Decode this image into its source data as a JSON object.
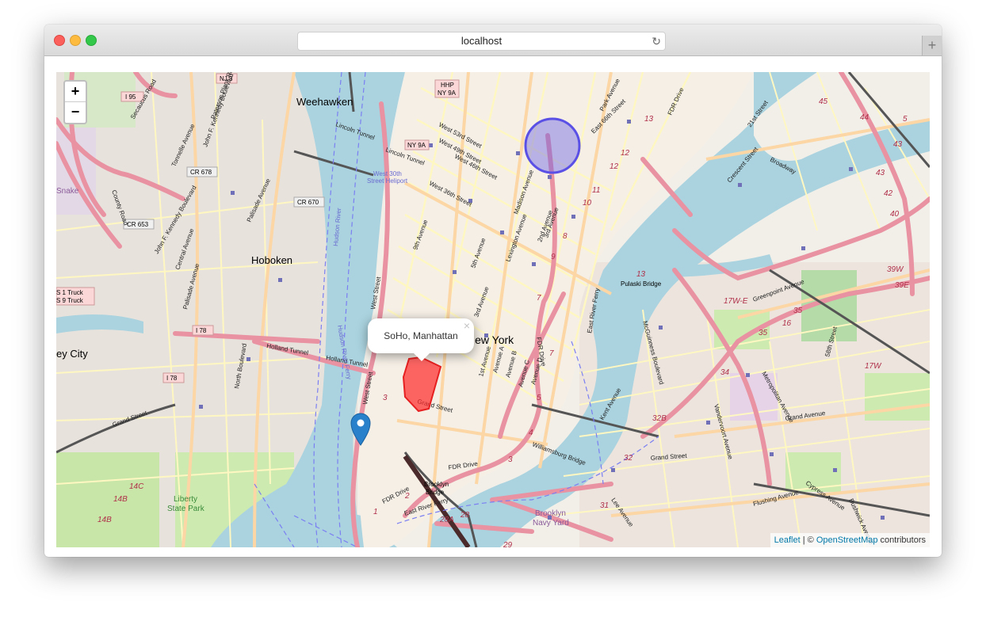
{
  "browser": {
    "url": "localhost",
    "new_tab_icon": "+",
    "reload_icon": "↻"
  },
  "map": {
    "zoom_in": "+",
    "zoom_out": "−",
    "popup": {
      "text": "SoHo, Manhattan",
      "close": "×"
    },
    "attribution": {
      "leaflet": "Leaflet",
      "separator": " | © ",
      "osm": "OpenStreetMap",
      "suffix": " contributors"
    },
    "colors": {
      "water": "#aad3df",
      "land": "#f2efe9",
      "park": "#cdebb0",
      "motorway": "#e892a2",
      "primary": "#fcd6a4",
      "circle": "#6d67e4",
      "polygon": "#ff2a2a",
      "marker": "#2a81cb"
    },
    "labels": {
      "weehawken": "Weehawken",
      "hoboken": "Hoboken",
      "newyork": "New York",
      "jerseycity": "ey City",
      "liberty": "Liberty",
      "statepark": "State Park",
      "brooklyn": "Brooklyn",
      "navyyard": "Navy Yard",
      "pulaski": "Pulaski Bridge",
      "brooklynbridge1": "Brooklyn",
      "brooklynbridge2": "Bridge",
      "heliport1": "West 30th",
      "heliport2": "Street Heliport",
      "snake": "Snake",
      "truck1": "S 1 Truck",
      "truck2": "S 9 Truck",
      "shields": {
        "nj3": "NJ 3",
        "i95": "I 95",
        "hhp": "HHP",
        "ny9a_top": "NY 9A",
        "ny9a": "NY 9A",
        "cr678": "CR 678",
        "cr670": "CR 670",
        "cr653": "CR 653",
        "i78": "I 78",
        "i78b": "I 78"
      },
      "streets": {
        "lincoln": "Lincoln Tunnel",
        "holland": "Holland Tunnel",
        "hollandtunnel2": "Holland Tunnel",
        "w53": "West 53rd Street",
        "w49": "West 49th Street",
        "w46": "West 46th Street",
        "w36": "West 36th Street",
        "westst": "West Street",
        "westst2": "West Street",
        "fdr": "FDR Drive",
        "fdr2": "FDR Drive",
        "fdr3": "FDR Drive",
        "fdr4": "FDR Drive",
        "grandst": "Grand Street",
        "grandst2": "Grand Street",
        "grandst3": "Grand Street",
        "grandave": "Grand Avenue",
        "williamsburg": "Williamsburg Bridge",
        "greenpoint": "Greenpoint Avenue",
        "broadway": "Broadway",
        "crescent": "Crescent Street",
        "palisade": "Palisade Avenue",
        "palisade2": "Palisade Avenue",
        "jfk": "John F. Kennedy Boulevard",
        "jfk2": "John F. Kennedy Boulevard",
        "central": "Central Avenue",
        "flushing": "Flushing Avenue",
        "cypress": "Cypress Avenue",
        "eastriver": "East River Ferry",
        "eastriver2": "East River Ferry",
        "mcguinness": "McGuinness Boulevard",
        "kent": "Kent Avenue",
        "parkave": "Park Avenue",
        "ave5": "5th Avenue",
        "ave9": "9th Avenue",
        "ave3": "3rd Avenue",
        "ave2": "2nd Avenue",
        "ave1": "1st Avenue",
        "lexington": "Lexington Avenue",
        "madison": "Madison Avenue",
        "avea": "Avenue A",
        "aveb": "Avenue B",
        "avec": "Avenue C",
        "aved": "Avenue D",
        "e66": "East 66th Street",
        "st21": "21st Street",
        "st58": "58th Street",
        "north": "North Boulevard",
        "county": "County Road",
        "hudson": "Hudson River",
        "hudson2": "Hudson River Ferry",
        "tonnele": "Tonnelle Avenue",
        "paterson": "Paterson Plank Road",
        "secaucus": "Secaucus Road",
        "bushwick": "Bushwick Avenue",
        "metro": "Metropolitan Avenue",
        "vandervoort": "Vandervoort Avenue",
        "lee": "Lee Avenue"
      },
      "exits": [
        "45",
        "44",
        "5",
        "43",
        "43",
        "42",
        "40",
        "39W",
        "39E",
        "13",
        "12",
        "12",
        "11",
        "10",
        "8",
        "9",
        "7",
        "7",
        "5",
        "4",
        "3",
        "3",
        "2",
        "1",
        "13",
        "17W-E",
        "35",
        "16",
        "35",
        "17W",
        "34",
        "32B",
        "32",
        "31",
        "28A",
        "28",
        "29",
        "14C",
        "14B",
        "14B",
        "3"
      ]
    }
  }
}
